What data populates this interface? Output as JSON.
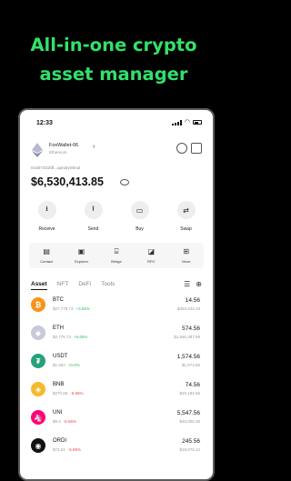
{
  "headline": {
    "line1": "All-in-one crypto",
    "line2": "asset manager"
  },
  "status": {
    "time": "12:33"
  },
  "wallet": {
    "name": "FoxWallet-06",
    "network": "Ethereum",
    "address": "0x1B7431fdf...uprubyShnul",
    "balance": "$6,530,413.85"
  },
  "actions": [
    {
      "label": "Receive",
      "icon": "⭳"
    },
    {
      "label": "Send",
      "icon": "⭱"
    },
    {
      "label": "Buy",
      "icon": "▭"
    },
    {
      "label": "Swap",
      "icon": "⇄"
    }
  ],
  "features": [
    {
      "label": "Contact",
      "icon": "▤"
    },
    {
      "label": "Explorer",
      "icon": "▣"
    },
    {
      "label": "Bridge",
      "icon": "⌸"
    },
    {
      "label": "RPC",
      "icon": "◪"
    },
    {
      "label": "More",
      "icon": "⊞"
    }
  ],
  "tabs": [
    "Asset",
    "NFT",
    "DeFi",
    "Tools"
  ],
  "assets": [
    {
      "symbol": "BTC",
      "price": "$27,778.73",
      "change": "+3.65%",
      "change_color": "#2ebd62",
      "qty": "14.56",
      "value": "$404,423.19",
      "coin_color": "#f7931a",
      "glyph": "₿"
    },
    {
      "symbol": "ETH",
      "price": "$2,775.73",
      "change": "+6.65%",
      "change_color": "#2ebd62",
      "qty": "574.56",
      "value": "$1,590,387.69",
      "coin_color": "#c9c9dc",
      "glyph": "◆"
    },
    {
      "symbol": "USDT",
      "price": "$1.002",
      "change": "+0.0%",
      "change_color": "#2ebd62",
      "qty": "1,574.56",
      "value": "$1,574.56",
      "coin_color": "#26a17b",
      "glyph": "₮"
    },
    {
      "symbol": "BNB",
      "price": "$270.69",
      "change": "-5.65%",
      "change_color": "#e5484d",
      "qty": "74.56",
      "value": "$20,182.56",
      "coin_color": "#f3ba2f",
      "glyph": "◈"
    },
    {
      "symbol": "UNI",
      "price": "$8.3",
      "change": "-6.66%",
      "change_color": "#e5484d",
      "qty": "5,547.56",
      "value": "$46,005.39",
      "coin_color": "#ff007a",
      "glyph": "🦄"
    },
    {
      "symbol": "ORDI",
      "price": "$73.61",
      "change": "-5.65%",
      "change_color": "#e5484d",
      "qty": "245.56",
      "value": "$18,075.12",
      "coin_color": "#111111",
      "glyph": "◉"
    }
  ]
}
